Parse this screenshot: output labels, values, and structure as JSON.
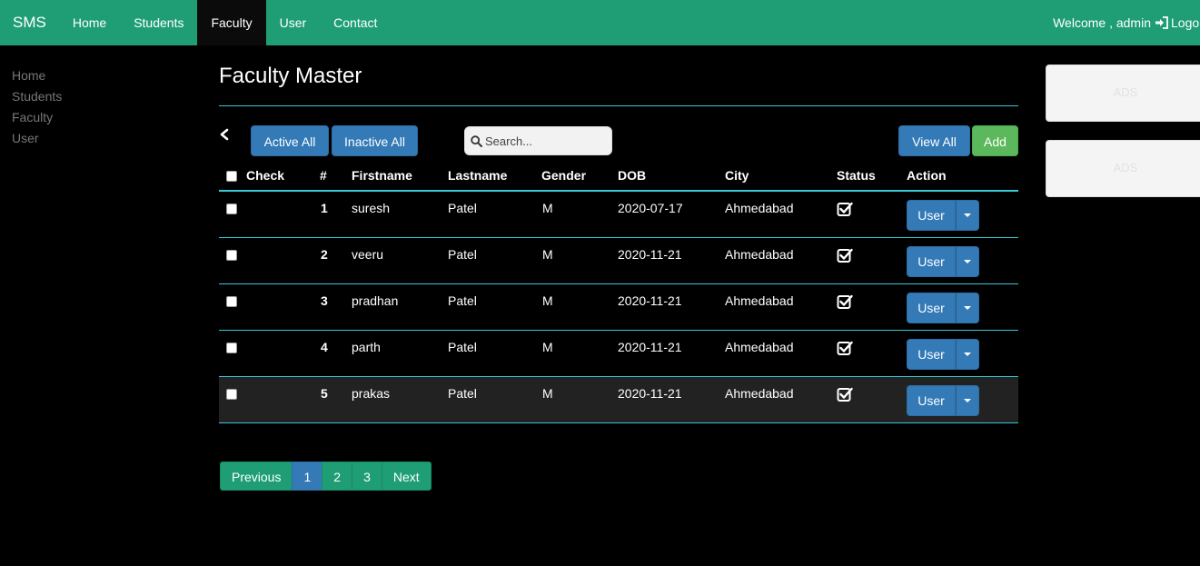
{
  "navbar": {
    "brand": "SMS",
    "items": [
      "Home",
      "Students",
      "Faculty",
      "User",
      "Contact"
    ],
    "active_item": "Faculty",
    "welcome": "Welcome , admin",
    "logout_label": "Logout"
  },
  "sidebar": {
    "items": [
      "Home",
      "Students",
      "Faculty",
      "User"
    ]
  },
  "main": {
    "title": "Faculty Master",
    "active_all_label": "Active All",
    "inactive_all_label": "Inactive All",
    "search_placeholder": "Search...",
    "view_all_label": "View All",
    "add_label": "Add"
  },
  "table": {
    "headers": {
      "check": "Check",
      "num": "#",
      "firstname": "Firstname",
      "lastname": "Lastname",
      "gender": "Gender",
      "dob": "DOB",
      "city": "City",
      "status": "Status",
      "action": "Action"
    },
    "rows": [
      {
        "num": "1",
        "firstname": "suresh",
        "lastname": "Patel",
        "gender": "M",
        "dob": "2020-07-17",
        "city": "Ahmedabad",
        "status": "active",
        "action_label": "User"
      },
      {
        "num": "2",
        "firstname": "veeru",
        "lastname": "Patel",
        "gender": "M",
        "dob": "2020-11-21",
        "city": "Ahmedabad",
        "status": "active",
        "action_label": "User"
      },
      {
        "num": "3",
        "firstname": "pradhan",
        "lastname": "Patel",
        "gender": "M",
        "dob": "2020-11-21",
        "city": "Ahmedabad",
        "status": "active",
        "action_label": "User"
      },
      {
        "num": "4",
        "firstname": "parth",
        "lastname": "Patel",
        "gender": "M",
        "dob": "2020-11-21",
        "city": "Ahmedabad",
        "status": "active",
        "action_label": "User"
      },
      {
        "num": "5",
        "firstname": "prakas",
        "lastname": "Patel",
        "gender": "M",
        "dob": "2020-11-21",
        "city": "Ahmedabad",
        "status": "active",
        "action_label": "User"
      }
    ]
  },
  "pagination": {
    "previous": "Previous",
    "pages": [
      "1",
      "2",
      "3"
    ],
    "current_page": "1",
    "next": "Next"
  },
  "ads": [
    "ADS",
    "ADS"
  ],
  "colors": {
    "navbar": "#1f9e75",
    "primary": "#337ab7",
    "success": "#5cb85c",
    "rule": "#36c9d6"
  },
  "icons": {
    "logout": "sign-out-icon",
    "back": "chevron-left-icon",
    "search": "search-icon",
    "status": "check-square-icon",
    "caret": "caret-down-icon"
  }
}
